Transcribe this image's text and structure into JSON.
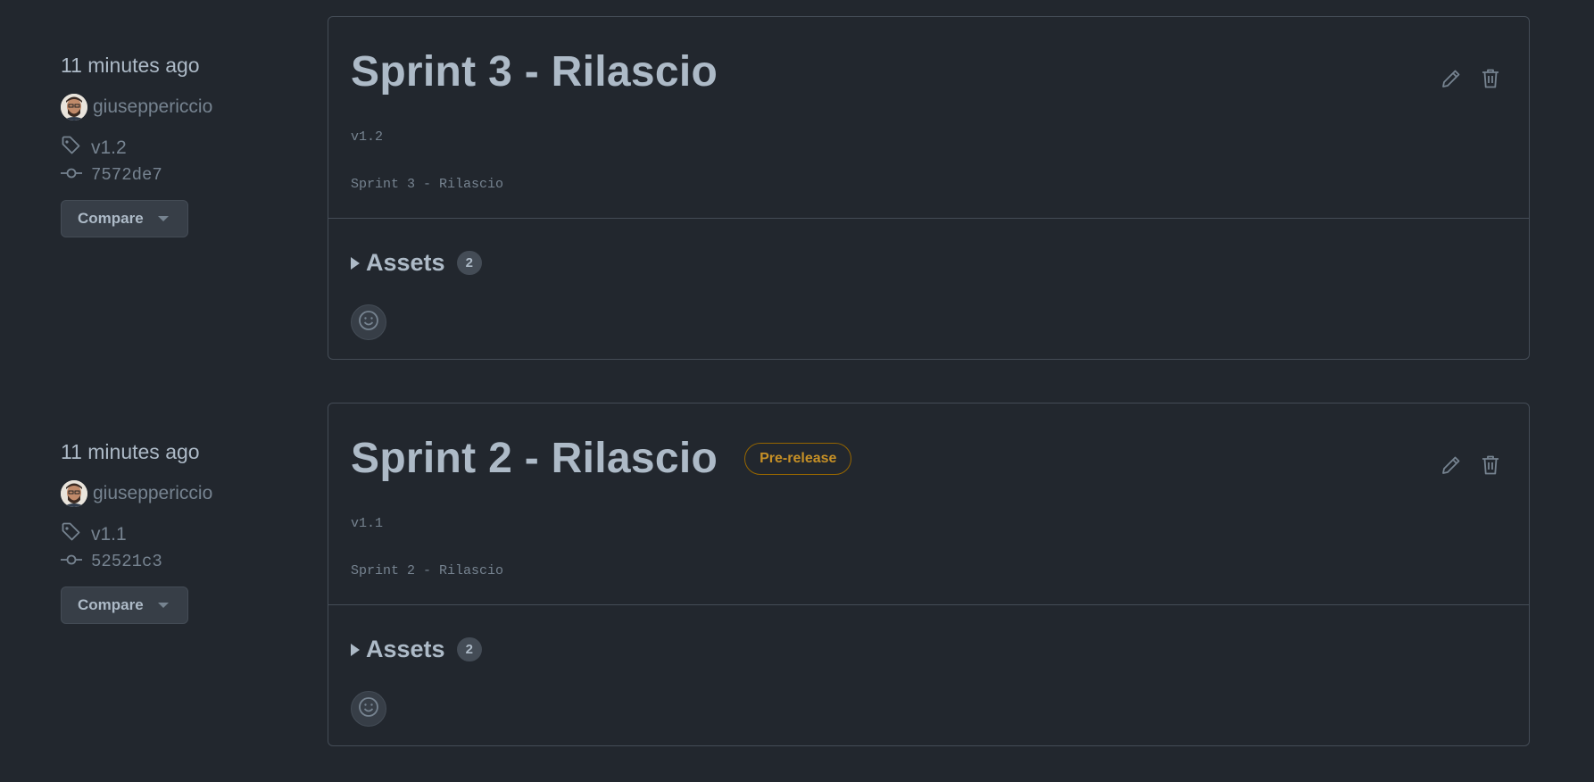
{
  "colors": {
    "background": "#22272e",
    "border": "#444c56",
    "text": "#adbac7",
    "muted": "#768390",
    "prerelease": "#c69026"
  },
  "releases": [
    {
      "time": "11 minutes ago",
      "author": "giuseppericcio",
      "tag": "v1.2",
      "commit": "7572de7",
      "compare_label": "Compare",
      "title": "Sprint 3 - Rilascio",
      "badge": "",
      "tag_name": "v1.2",
      "description": "Sprint 3 - Rilascio",
      "assets_label": "Assets",
      "assets_count": "2"
    },
    {
      "time": "11 minutes ago",
      "author": "giuseppericcio",
      "tag": "v1.1",
      "commit": "52521c3",
      "compare_label": "Compare",
      "title": "Sprint 2 - Rilascio",
      "badge": "Pre-release",
      "tag_name": "v1.1",
      "description": "Sprint 2 - Rilascio",
      "assets_label": "Assets",
      "assets_count": "2"
    }
  ],
  "icons": {
    "edit": "pencil-icon",
    "delete": "trash-icon",
    "tag": "tag-icon",
    "commit": "commit-icon",
    "reaction": "smiley-icon",
    "expand": "triangle-right-icon",
    "dropdown": "caret-down-icon"
  }
}
